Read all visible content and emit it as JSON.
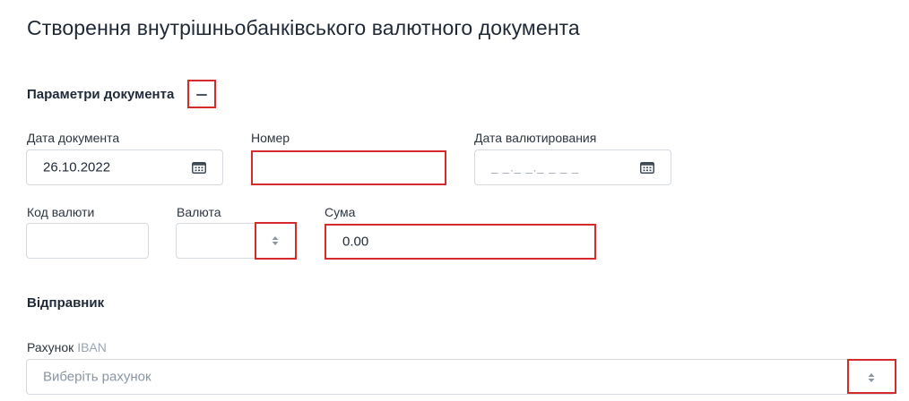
{
  "page": {
    "title": "Створення внутрішньобанківського валютного документа"
  },
  "params_section": {
    "title": "Параметри документа"
  },
  "fields": {
    "doc_date": {
      "label": "Дата документа",
      "value": "26.10.2022"
    },
    "number": {
      "label": "Номер",
      "value": ""
    },
    "value_date": {
      "label": "Дата валютирования",
      "mask": "_ _._ _._ _ _ _"
    },
    "currency_code": {
      "label": "Код валюти",
      "value": ""
    },
    "currency": {
      "label": "Валюта",
      "value": ""
    },
    "amount": {
      "label": "Сума",
      "value": "0.00"
    }
  },
  "sender_section": {
    "title": "Відправник",
    "account_label": "Рахунок",
    "account_label_suffix": "IBAN",
    "account_placeholder": "Виберіть рахунок"
  },
  "icons": {
    "calendar": "calendar-icon",
    "sort": "sort-arrows-icon",
    "collapse": "minus-icon"
  },
  "colors": {
    "highlight": "#d42b2b",
    "border": "#d5dae0",
    "text": "#1f2937",
    "placeholder": "#8a96a3"
  }
}
